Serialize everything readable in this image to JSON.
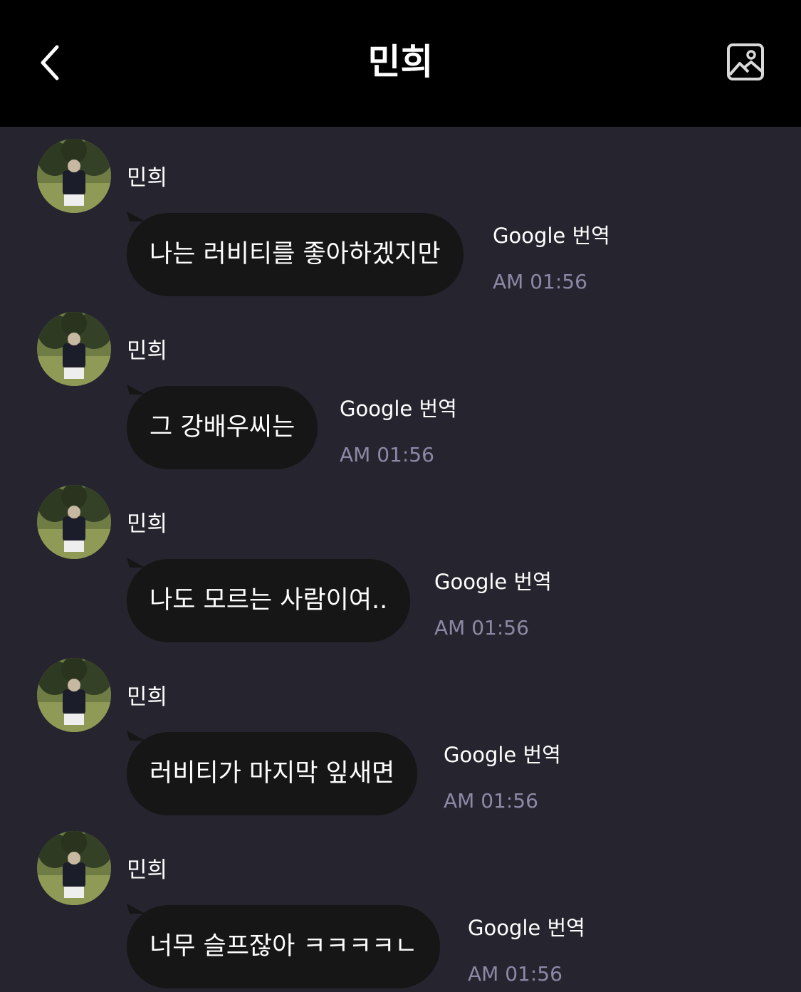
{
  "header": {
    "title": "민희",
    "back_icon": "chevron-left-icon",
    "gallery_icon": "image-gallery-icon"
  },
  "colors": {
    "header_bg": "#000000",
    "chat_bg": "#26252f",
    "bubble_bg": "#161616",
    "time_text": "#8d88a6"
  },
  "messages": [
    {
      "sender": "민희",
      "text": "나는 러비티를 좋아하겠지만",
      "translate_label": "Google 번역",
      "time": "AM 01:56"
    },
    {
      "sender": "민희",
      "text": "그 강배우씨는",
      "translate_label": "Google 번역",
      "time": "AM 01:56"
    },
    {
      "sender": "민희",
      "text": "나도 모르는 사람이여..",
      "translate_label": "Google 번역",
      "time": "AM 01:56"
    },
    {
      "sender": "민희",
      "text": "러비티가 마지막 잎새면",
      "translate_label": "Google 번역",
      "time": "AM 01:56"
    },
    {
      "sender": "민희",
      "text": "너무 슬프잖아 ㅋㅋㅋㅋㄴ",
      "translate_label": "Google 번역",
      "time": "AM 01:56"
    }
  ]
}
